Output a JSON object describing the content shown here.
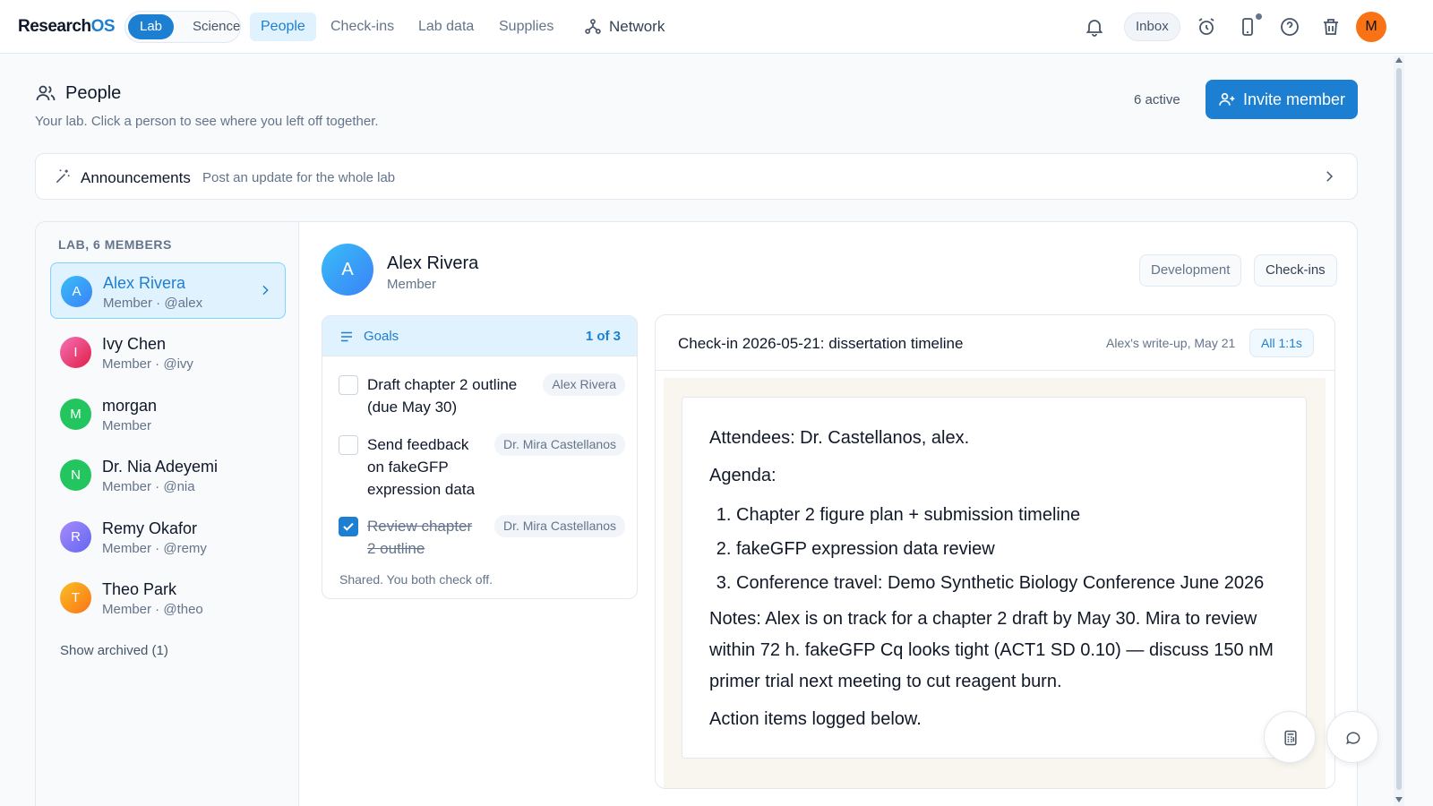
{
  "app": {
    "logo_main": "Research",
    "logo_accent": "OS"
  },
  "nav": {
    "mode_options": [
      "Lab",
      "Science"
    ],
    "items": [
      "People",
      "Check-ins",
      "Lab data",
      "Supplies"
    ],
    "network_label": "Network",
    "inbox_label": "Inbox",
    "user_initial": "M"
  },
  "page": {
    "title": "People",
    "subtitle": "Your lab. Click a person to see where you left off together.",
    "active_count": "6 active",
    "invite_label": "Invite member"
  },
  "announcements": {
    "title": "Announcements",
    "hint": "Post an update for the whole lab"
  },
  "sidebar": {
    "heading": "LAB, 6 MEMBERS",
    "members": [
      {
        "initial": "A",
        "name": "Alex Rivera",
        "role": "Member · @alex",
        "color": "#38bdf8"
      },
      {
        "initial": "I",
        "name": "Ivy Chen",
        "role": "Member · @ivy",
        "color": "#ec4899"
      },
      {
        "initial": "M",
        "name": "morgan",
        "role": "Member",
        "color": "#22c55e"
      },
      {
        "initial": "N",
        "name": "Dr. Nia Adeyemi",
        "role": "Member · @nia",
        "color": "#22c55e"
      },
      {
        "initial": "R",
        "name": "Remy Okafor",
        "role": "Member · @remy",
        "color": "#8b5cf6"
      },
      {
        "initial": "T",
        "name": "Theo Park",
        "role": "Member · @theo",
        "color": "#f97316"
      }
    ],
    "archived_label": "Show archived (1)"
  },
  "detail": {
    "initial": "A",
    "name": "Alex Rivera",
    "role": "Member",
    "tabs": [
      "Development",
      "Check-ins"
    ]
  },
  "goals": {
    "title": "Goals",
    "count": "1 of 3",
    "items": [
      {
        "text": "Draft chapter 2 outline (due May 30)",
        "owner": "Alex Rivera",
        "done": false
      },
      {
        "text": "Send feedback on fakeGFP expression data",
        "owner": "Dr. Mira Castellanos",
        "done": false
      },
      {
        "text": "Review chapter 2 outline",
        "owner": "Dr. Mira Castellanos",
        "done": true
      }
    ],
    "footer": "Shared. You both check off."
  },
  "checkin": {
    "title": "Check-in 2026-05-21: dissertation timeline",
    "meta": "Alex's write-up, May 21",
    "all_label": "All 1:1s",
    "attendees": "Attendees: Dr. Castellanos, alex.",
    "agenda_label": "Agenda:",
    "agenda": [
      "Chapter 2 figure plan + submission timeline",
      "fakeGFP expression data review",
      "Conference travel: Demo Synthetic Biology Conference June 2026"
    ],
    "notes": "Notes: Alex is on track for a chapter 2 draft by May 30. Mira to review within 72 h. fakeGFP Cq looks tight (ACT1 SD 0.10) — discuss 150 nM primer trial next meeting to cut reagent burn.",
    "footer": "Action items logged below."
  },
  "colors": {
    "accent": "#1d7fd1",
    "accent_light": "#e0f2fe"
  }
}
